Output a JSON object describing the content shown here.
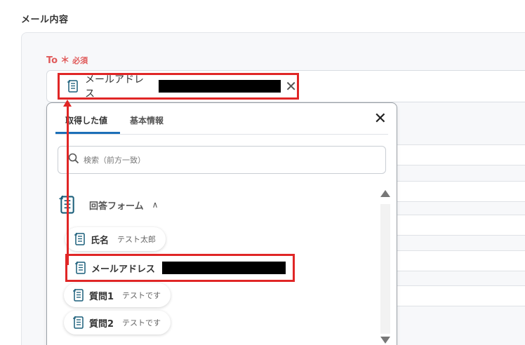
{
  "section_title": "メール内容",
  "to_field": {
    "label": "To",
    "required_mark": "＊",
    "required_text": "必須",
    "chip_label": "メールアドレス",
    "remove_glyph": "✕"
  },
  "dropdown": {
    "tabs": [
      {
        "label": "取得した値",
        "active": true
      },
      {
        "label": "基本情報",
        "active": false
      }
    ],
    "close_glyph": "✕",
    "search_placeholder": "検索（前方一致）",
    "group": {
      "title": "回答フォーム",
      "chevron": "∧",
      "items": [
        {
          "name": "氏名",
          "value": "テスト太郎"
        },
        {
          "name": "メールアドレス",
          "value": ""
        },
        {
          "name": "質問1",
          "value": "テストです"
        },
        {
          "name": "質問2",
          "value": "テストです"
        }
      ]
    }
  },
  "colors": {
    "highlight": "#e02626",
    "tab_active": "#1d6fb8",
    "required": "#e05a5a"
  },
  "icons": {
    "field_icon": "document-list-icon",
    "search": "search-icon",
    "close": "close-icon"
  }
}
